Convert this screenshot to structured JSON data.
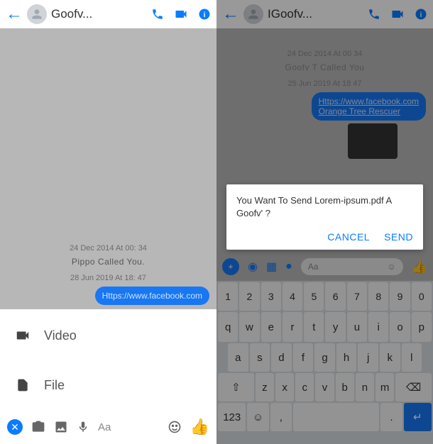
{
  "left": {
    "header": {
      "name": "Goofv..."
    },
    "timestamps": {
      "t1": "24 Dec 2014 At 00: 34",
      "t2": "28 Jun 2019 At 18: 47"
    },
    "syscall": "Pippo Called You.",
    "bubble_link": "Https://www.facebook.com",
    "attach": {
      "video": "Video",
      "file": "File"
    },
    "composer": {
      "aa": "Aa"
    }
  },
  "right": {
    "header": {
      "name": "IGoofv..."
    },
    "timestamps": {
      "t1": "24 Dec 2014 At 00 34",
      "t2": "25 Jun 2019 At 18 47"
    },
    "syscall": "Goofv T Called You",
    "bubble": {
      "line1": "Https://www.facebook.com",
      "line2": "Orange Tree Rescuer"
    },
    "dialog": {
      "message": "You Want To Send Lorem-ipsum.pdf A Goofv'           ?",
      "cancel": "CANCEL",
      "send": "SEND"
    },
    "composer": {
      "aa": "Aa"
    },
    "keyboard": {
      "nums": [
        "1",
        "2",
        "3",
        "4",
        "5",
        "6",
        "7",
        "8",
        "9",
        "0"
      ],
      "r2": [
        "q",
        "w",
        "e",
        "r",
        "t",
        "y",
        "u",
        "i",
        "o",
        "p"
      ],
      "r3": [
        "a",
        "s",
        "d",
        "f",
        "g",
        "h",
        "j",
        "k",
        "l"
      ],
      "r4": [
        "z",
        "x",
        "c",
        "v",
        "b",
        "n",
        "m"
      ],
      "k123": "123"
    }
  }
}
